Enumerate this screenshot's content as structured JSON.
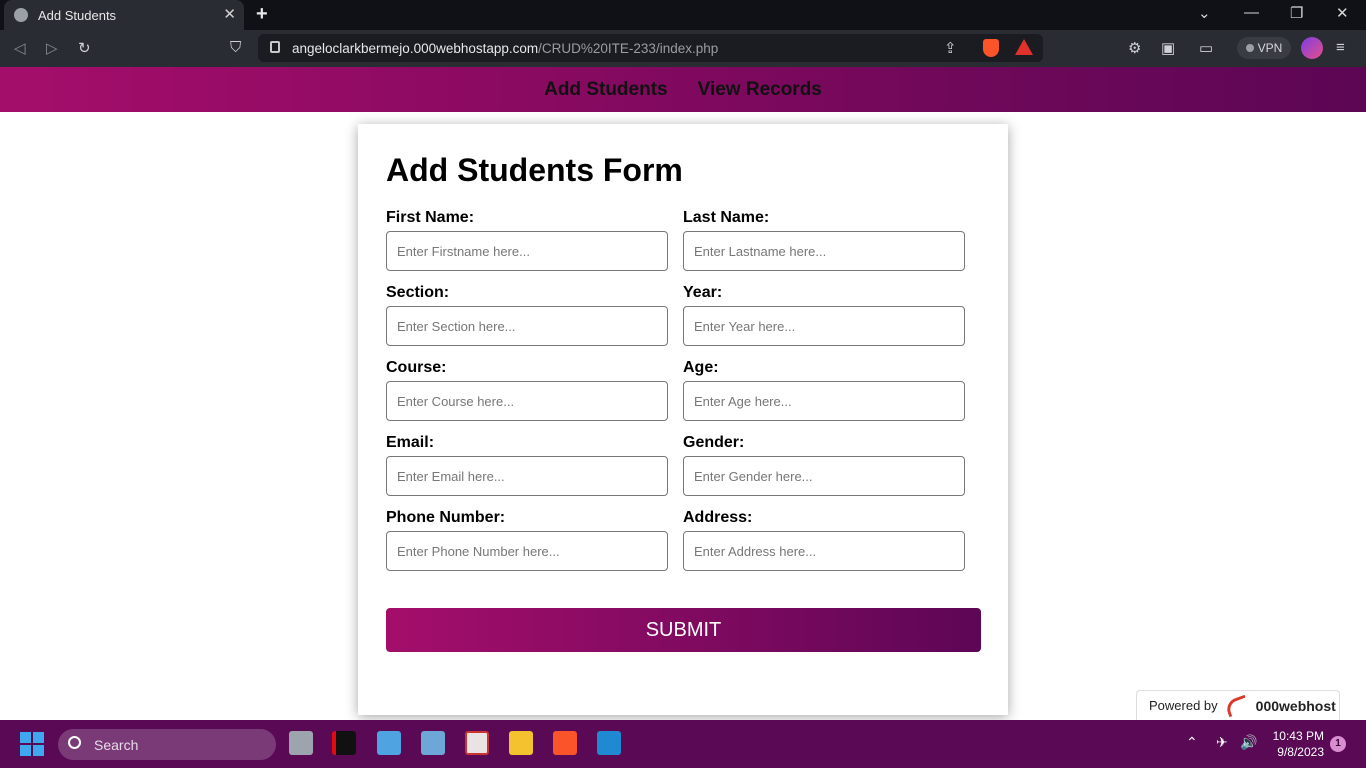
{
  "browser": {
    "tab_title": "Add Students",
    "tab_close": "✕",
    "new_tab": "+",
    "url_host": "angeloclarkbermejo.000webhostapp.com",
    "url_path": "/CRUD%20ITE-233/index.php",
    "vpn_label": "VPN",
    "min_icon": "—",
    "max_icon": "❐",
    "close_icon": "✕",
    "chevron_icon": "⌄"
  },
  "nav": {
    "add_students": "Add Students",
    "view_records": "View Records"
  },
  "form": {
    "title": "Add Students Form",
    "fields": [
      {
        "label": "First Name:",
        "placeholder": "Enter Firstname here..."
      },
      {
        "label": "Last Name:",
        "placeholder": "Enter Lastname here..."
      },
      {
        "label": "Section:",
        "placeholder": "Enter Section here..."
      },
      {
        "label": "Year:",
        "placeholder": "Enter Year here..."
      },
      {
        "label": "Course:",
        "placeholder": "Enter Course here..."
      },
      {
        "label": "Age:",
        "placeholder": "Enter Age here..."
      },
      {
        "label": "Email:",
        "placeholder": "Enter Email here..."
      },
      {
        "label": "Gender:",
        "placeholder": "Enter Gender here..."
      },
      {
        "label": "Phone Number:",
        "placeholder": "Enter Phone Number here..."
      },
      {
        "label": "Address:",
        "placeholder": "Enter Address here..."
      }
    ],
    "submit_label": "SUBMIT"
  },
  "footer": {
    "powered_by": "Powered by",
    "brand": "000webhost"
  },
  "taskbar": {
    "search_label": "Search",
    "time": "10:43 PM",
    "date": "9/8/2023",
    "notification_count": "1"
  },
  "colors": {
    "accent_start": "#a40e6b",
    "accent_end": "#5e0656",
    "taskbar": "#5a0a55"
  }
}
